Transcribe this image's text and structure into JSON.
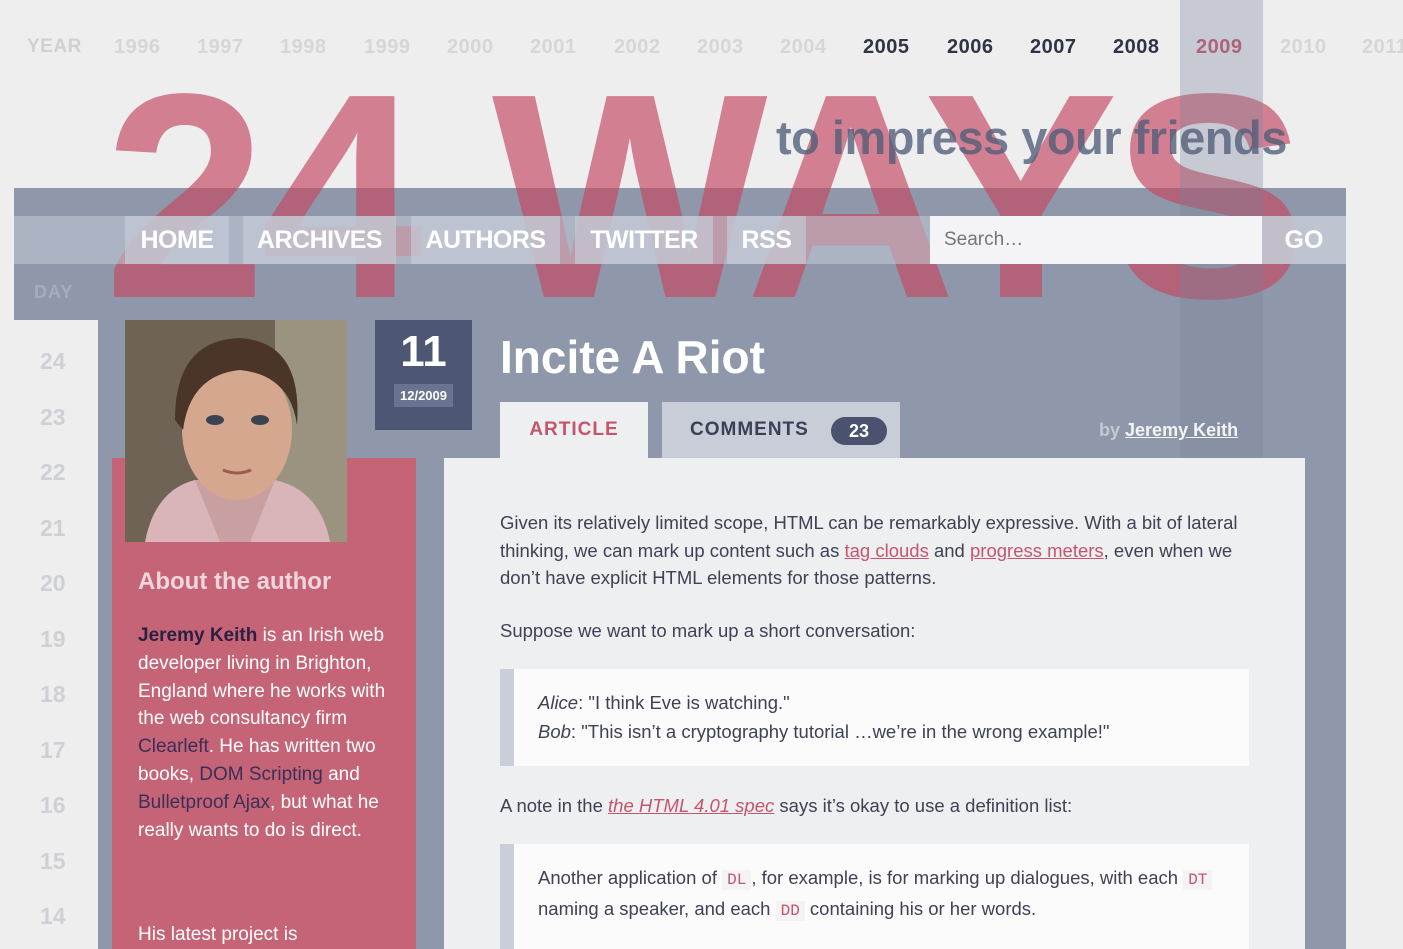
{
  "years": {
    "label": "YEAR",
    "list": [
      "1996",
      "1997",
      "1998",
      "1999",
      "2000",
      "2001",
      "2002",
      "2003",
      "2004",
      "2005",
      "2006",
      "2007",
      "2008",
      "2009",
      "2010",
      "2011"
    ]
  },
  "header": {
    "logo": "24 WAYS",
    "tagline": "to impress your friends"
  },
  "nav": {
    "items": [
      "HOME",
      "ARCHIVES",
      "AUTHORS",
      "TWITTER",
      "RSS"
    ],
    "search_placeholder": "Search…",
    "go_label": "GO"
  },
  "days": {
    "label": "DAY",
    "list": [
      "24",
      "23",
      "22",
      "21",
      "20",
      "19",
      "18",
      "17",
      "16",
      "15",
      "14"
    ]
  },
  "date": {
    "day": "11",
    "month_year": "12/2009"
  },
  "article": {
    "title": "Incite A Riot",
    "tab_article": "ARTICLE",
    "tab_comments": "COMMENTS",
    "comment_count": "23",
    "by_label": "by",
    "author": "Jeremy Keith",
    "p1_a": "Given its relatively limited scope, HTML can be remarkably expressive. With a bit of lateral thinking, we can mark up content such as ",
    "p1_link1": "tag clouds",
    "p1_b": " and ",
    "p1_link2": "progress meters",
    "p1_c": ", even when we don’t have explicit HTML elements for those patterns.",
    "p2": "Suppose we want to mark up a short conversation:",
    "quote1": {
      "speaker1": "Alice",
      "line1": ": \"I think Eve is watching.\"",
      "speaker2": "Bob",
      "line2": ": \"This isn’t a cryptography tutorial …we’re in the wrong example!\""
    },
    "p3_a": "A note in the ",
    "p3_link": "the HTML 4.01 spec",
    "p3_b": " says it’s okay to use a definition list:",
    "quote2": {
      "a": "Another application of ",
      "code1": "DL",
      "b": ", for example, is for marking up dialogues, with each ",
      "code2": "DT",
      "c": " naming a speaker, and each ",
      "code3": "DD",
      "d": " containing his or her words."
    }
  },
  "author_box": {
    "title": "About the author",
    "name": "Jeremy Keith",
    "t1": " is an Irish web developer living in Brighton, England where he works with the web consultancy firm ",
    "link_clearleft": "Clearleft",
    "t2": ". He has written two books, ",
    "link_book1": "DOM Scripting",
    "t3": " and ",
    "link_book2": "Bulletproof Ajax",
    "t4": ", but what he really wants to do is direct.",
    "latest": "His latest project is"
  },
  "colors": {
    "accent": "#c4566c",
    "slate": "#8f98aa",
    "author_box": "#c66477",
    "badge": "#4d5673"
  }
}
